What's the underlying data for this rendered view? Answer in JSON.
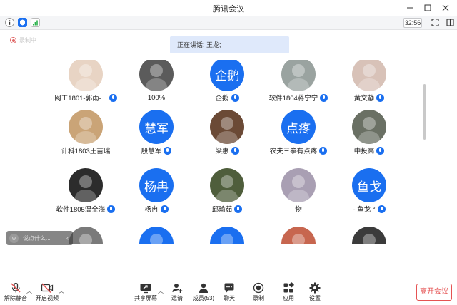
{
  "window": {
    "title": "腾讯会议"
  },
  "toolbar": {
    "timer": "32:56"
  },
  "recording": {
    "label": "录制中"
  },
  "speaker": {
    "text": "正在讲话: 王龙;"
  },
  "participants": [
    {
      "name": "网工1801-郭雨-...",
      "avatar_text": "",
      "avatar_color": "#e8d4c4",
      "mic": true
    },
    {
      "name": "100%",
      "avatar_text": "",
      "avatar_color": "#5b5b5b",
      "mic": false
    },
    {
      "name": "企鹅",
      "avatar_text": "企鹅",
      "avatar_color": "#1a6ff0",
      "mic": true
    },
    {
      "name": "软件1804蒋宁宁",
      "avatar_text": "",
      "avatar_color": "#9aa3a0",
      "mic": true
    },
    {
      "name": "黄文静",
      "avatar_text": "",
      "avatar_color": "#d8c2b8",
      "mic": true
    },
    {
      "name": "计科1803王苗瑞",
      "avatar_text": "",
      "avatar_color": "#caa477",
      "mic": false
    },
    {
      "name": "殷慧军",
      "avatar_text": "慧军",
      "avatar_color": "#1a6ff0",
      "mic": true
    },
    {
      "name": "梁惠",
      "avatar_text": "",
      "avatar_color": "#6b4a36",
      "mic": true
    },
    {
      "name": "农夫三拳有点疼",
      "avatar_text": "点疼",
      "avatar_color": "#1a6ff0",
      "mic": true
    },
    {
      "name": "中投高",
      "avatar_text": "",
      "avatar_color": "#6a7064",
      "mic": true
    },
    {
      "name": "软件1805温全海",
      "avatar_text": "",
      "avatar_color": "#2c2c2c",
      "mic": true
    },
    {
      "name": "杨冉",
      "avatar_text": "杨冉",
      "avatar_color": "#1a6ff0",
      "mic": true
    },
    {
      "name": "邱瑜茹",
      "avatar_text": "",
      "avatar_color": "#4f5e3c",
      "mic": true
    },
    {
      "name": "物",
      "avatar_text": "",
      "avatar_color": "#a99fb3",
      "mic": false
    },
    {
      "name": "- 鱼戈 °",
      "avatar_text": "鱼戈",
      "avatar_color": "#1a6ff0",
      "mic": true
    },
    {
      "name": "",
      "avatar_text": "",
      "avatar_color": "#7a7a7a",
      "mic": false
    },
    {
      "name": "",
      "avatar_text": "",
      "avatar_color": "#1a6ff0",
      "mic": false
    },
    {
      "name": "",
      "avatar_text": "",
      "avatar_color": "#1a6ff0",
      "mic": false
    },
    {
      "name": "",
      "avatar_text": "",
      "avatar_color": "#c7664f",
      "mic": false
    },
    {
      "name": "",
      "avatar_text": "",
      "avatar_color": "#3b3b3b",
      "mic": false
    }
  ],
  "chat": {
    "placeholder": "说点什么..."
  },
  "bottom_bar": {
    "unmute": "解除静音",
    "start_video": "开启视频",
    "share_screen": "共享屏幕",
    "invite": "邀请",
    "members": "成员(53)",
    "chat": "聊天",
    "record": "录制",
    "apps": "应用",
    "settings": "设置",
    "leave": "离开会议"
  },
  "colors": {
    "accent": "#1a6ff0",
    "danger": "#e55353",
    "speaker_bg": "#dfe9fb"
  }
}
